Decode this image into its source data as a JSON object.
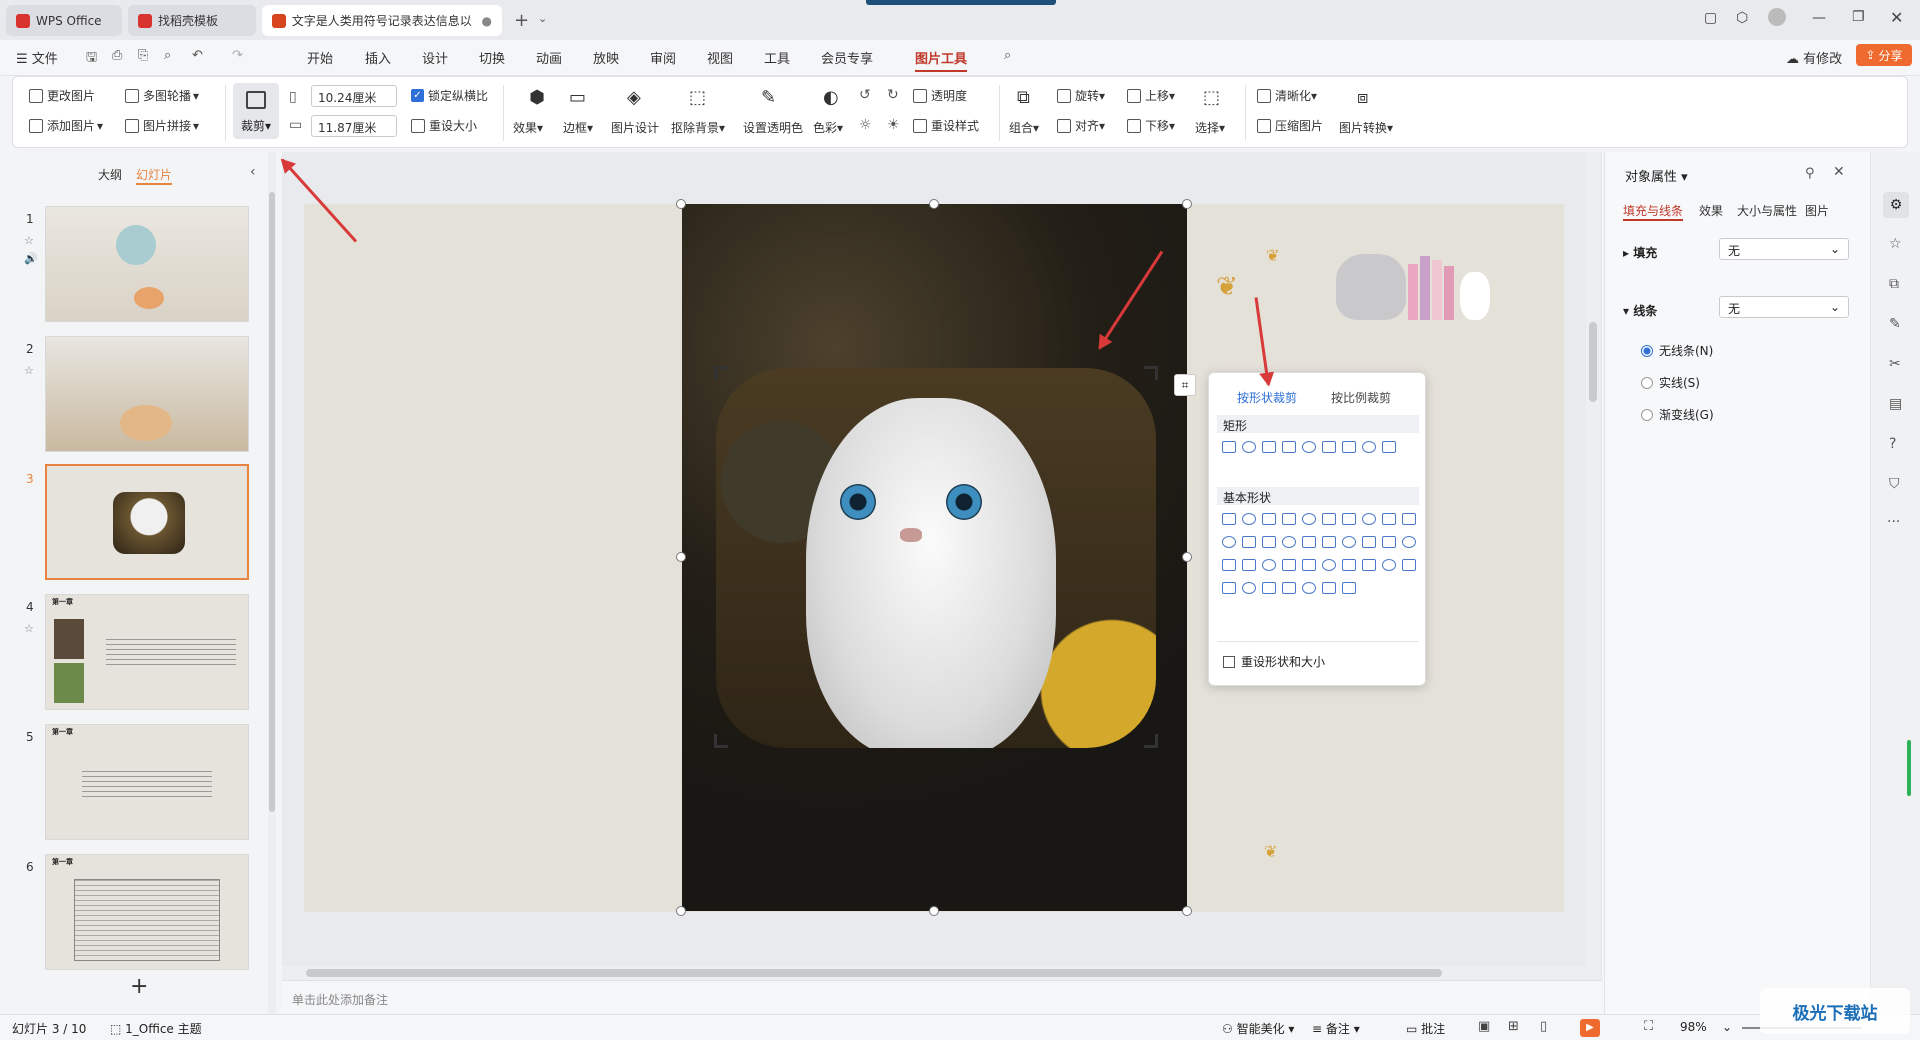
{
  "tabs": [
    {
      "label": "WPS Office",
      "icon": "wps-logo-icon",
      "color": "#d8332f"
    },
    {
      "label": "找稻壳模板",
      "icon": "docer-icon",
      "color": "#d8332f"
    },
    {
      "label": "文字是人类用符号记录表达信息以",
      "icon": "ppt-file-icon",
      "color": "#d6451e"
    }
  ],
  "menu": {
    "file": "文件",
    "items": [
      "开始",
      "插入",
      "设计",
      "切换",
      "动画",
      "放映",
      "审阅",
      "视图",
      "工具",
      "会员专享",
      "图片工具"
    ],
    "active": "图片工具",
    "has_changes": "有修改",
    "share": "分享"
  },
  "ribbon": {
    "change_pic": "更改图片",
    "multi_carousel": "多图轮播",
    "add_pic": "添加图片",
    "pic_collage": "图片拼接",
    "crop": "裁剪",
    "width": "10.24厘米",
    "height": "11.87厘米",
    "lock_ratio": "锁定纵横比",
    "reset_size": "重设大小",
    "effects": "效果",
    "border": "边框",
    "pic_design": "图片设计",
    "remove_bg": "抠除背景",
    "set_transparent": "设置透明色",
    "color": "色彩",
    "transparency": "透明度",
    "reset_style": "重设样式",
    "rotate": "旋转",
    "move_up": "上移",
    "combine": "组合",
    "align": "对齐",
    "move_down": "下移",
    "select": "选择",
    "sharpen": "清晰化",
    "compress": "压缩图片",
    "convert": "图片转换"
  },
  "left_panel": {
    "tab_outline": "大纲",
    "tab_slides": "幻灯片",
    "slide_numbers": [
      "1",
      "2",
      "3",
      "4",
      "5",
      "6"
    ],
    "chapter_label": "第一章",
    "add": "+"
  },
  "crop_menu": {
    "tab_shape": "按形状裁剪",
    "tab_ratio": "按比例裁剪",
    "section_rect": "矩形",
    "section_basic": "基本形状",
    "reset": "重设形状和大小"
  },
  "right_panel": {
    "title": "对象属性",
    "tabs": [
      "填充与线条",
      "效果",
      "大小与属性",
      "图片"
    ],
    "fill_label": "填充",
    "fill_value": "无",
    "line_label": "线条",
    "line_value": "无",
    "options": [
      "无线条(N)",
      "实线(S)",
      "渐变线(G)"
    ]
  },
  "notes_placeholder": "单击此处添加备注",
  "status": {
    "slide_info": "幻灯片 3 / 10",
    "theme": "1_Office 主题",
    "beautify": "智能美化",
    "notes": "备注",
    "comments": "批注",
    "zoom": "98%"
  },
  "watermark": "极光下载站"
}
